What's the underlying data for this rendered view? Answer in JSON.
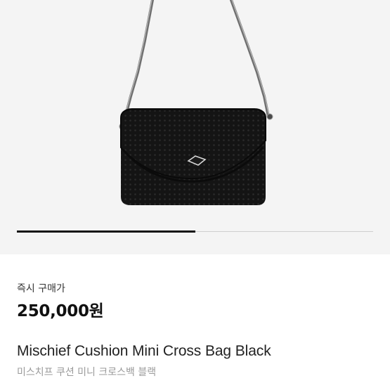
{
  "gallery": {
    "image_alt": "black perforated mini cross bag with metal strap",
    "current_position": 0.5
  },
  "purchase": {
    "label": "즉시 구매가",
    "price": "250,000원"
  },
  "product": {
    "name_en": "Mischief Cushion Mini Cross Bag Black",
    "name_ko": "미스치프 쿠션 미니 크로스백 블랙"
  },
  "colors": {
    "background": "#f4f4f4",
    "bag": "#141414",
    "strap": "#6f6f6f"
  }
}
